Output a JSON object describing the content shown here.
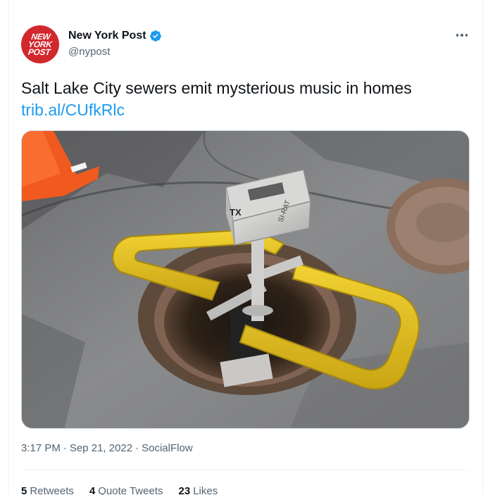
{
  "tweet": {
    "avatar": {
      "logo_lines": [
        "NEW",
        "YORK",
        "POST"
      ],
      "brand_color": "#d1282e"
    },
    "author": {
      "display_name": "New York Post",
      "handle": "@nypost",
      "verified": true,
      "verified_color": "#1d9bf0"
    },
    "more_menu_icon": "ellipsis-icon",
    "text": "Salt Lake City sewers emit mysterious music in homes",
    "link": "trib.al/CUfkRlc",
    "link_color": "#1d9bf0",
    "media": {
      "description_icon": "photo",
      "box_labels": [
        "TX",
        "SI-RAT"
      ]
    },
    "meta": {
      "time": "3:17 PM",
      "sep1": "·",
      "date": "Sep 21, 2022",
      "sep2": "·",
      "source": "SocialFlow"
    },
    "stats": [
      {
        "count": "5",
        "label": "Retweets"
      },
      {
        "count": "4",
        "label": "Quote Tweets"
      },
      {
        "count": "23",
        "label": "Likes"
      }
    ]
  }
}
